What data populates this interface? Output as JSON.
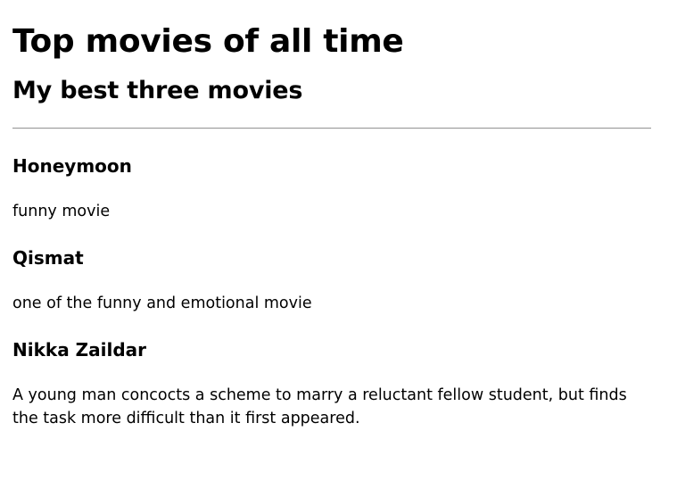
{
  "page": {
    "title": "Top movies of all time",
    "subtitle": "My best three movies"
  },
  "movies": [
    {
      "name": "Honeymoon",
      "description": "funny movie"
    },
    {
      "name": "Qismat",
      "description": "one of the funny and emotional movie"
    },
    {
      "name": "Nikka Zaildar",
      "description": "A young man concocts a scheme to marry a reluctant fellow student, but finds the task more difficult than it first appeared."
    }
  ]
}
